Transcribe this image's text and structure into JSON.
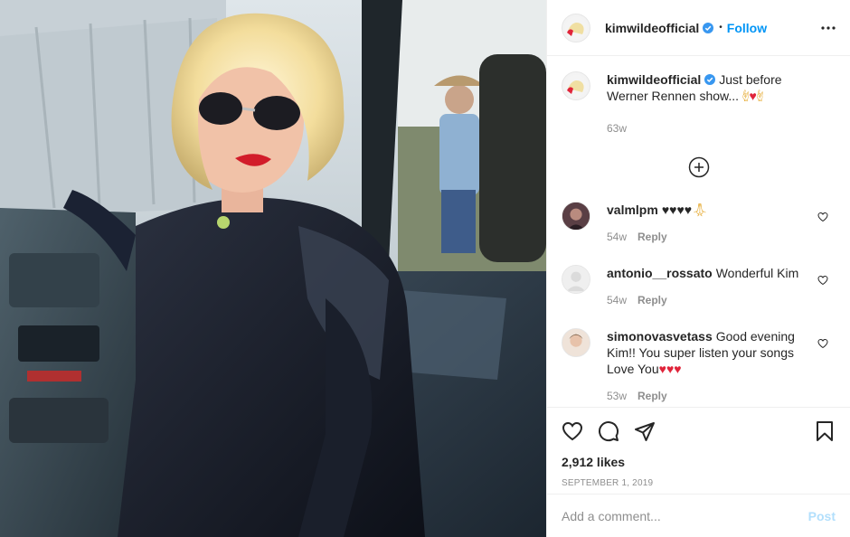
{
  "photo": {
    "icon": "photo-of-woman-in-van"
  },
  "header": {
    "username": "kimwildeofficial",
    "verified_icon": "verified-badge-icon",
    "separator": "•",
    "follow_label": "Follow",
    "more_icon": "more-options-icon"
  },
  "caption": {
    "username": "kimwildeofficial",
    "text": "Just before Werner Rennen show...",
    "emojis": [
      "metal-hand",
      "red-heart",
      "metal-hand"
    ],
    "time": "63w"
  },
  "load_more_icon": "plus-circle-icon",
  "comments": [
    {
      "username": "valmlpm",
      "text": "♥♥♥♥",
      "emoji": "praying-hands",
      "time": "54w",
      "reply_label": "Reply"
    },
    {
      "username": "antonio__rossato",
      "text": "Wonderful Kim",
      "time": "54w",
      "reply_label": "Reply"
    },
    {
      "username": "simonovasvetass",
      "text": "Good evening Kim!! You super listen your songs Love You",
      "emojis": [
        "red-heart",
        "red-heart",
        "red-heart"
      ],
      "time": "53w",
      "reply_label": "Reply"
    }
  ],
  "actions": {
    "like_icon": "heart-icon",
    "comment_icon": "comment-icon",
    "share_icon": "share-icon",
    "save_icon": "bookmark-icon",
    "likes": "2,912 likes",
    "date": "SEPTEMBER 1, 2019"
  },
  "add_comment": {
    "placeholder": "Add a comment...",
    "post_label": "Post"
  },
  "colors": {
    "accent": "#0095f6",
    "muted": "#8e8e8e",
    "heart": "#e0245e",
    "post_disabled": "#b2dffc"
  }
}
